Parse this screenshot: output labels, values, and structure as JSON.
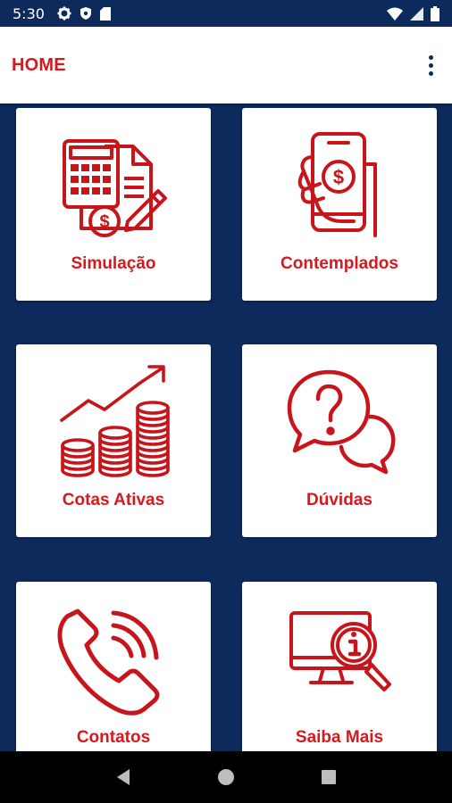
{
  "status_bar": {
    "time": "5:30",
    "icons": [
      "gear-icon",
      "shield-icon",
      "sd-card-icon",
      "wifi-icon",
      "signal-icon",
      "battery-icon"
    ]
  },
  "app_bar": {
    "title": "HOME",
    "menu_icon": "more-vert-icon"
  },
  "colors": {
    "primary": "#0d2a5c",
    "accent": "#d41a1f",
    "card": "#ffffff"
  },
  "menu": [
    {
      "label": "Simulação",
      "icon": "calculator-document-icon"
    },
    {
      "label": "Contemplados",
      "icon": "phone-payment-icon"
    },
    {
      "label": "Cotas Ativas",
      "icon": "coins-growth-icon"
    },
    {
      "label": "Dúvidas",
      "icon": "question-chat-icon"
    },
    {
      "label": "Contatos",
      "icon": "phone-icon"
    },
    {
      "label": "Saiba Mais",
      "icon": "info-search-icon"
    }
  ],
  "nav_bar": [
    "back-icon",
    "home-icon",
    "recents-icon"
  ]
}
